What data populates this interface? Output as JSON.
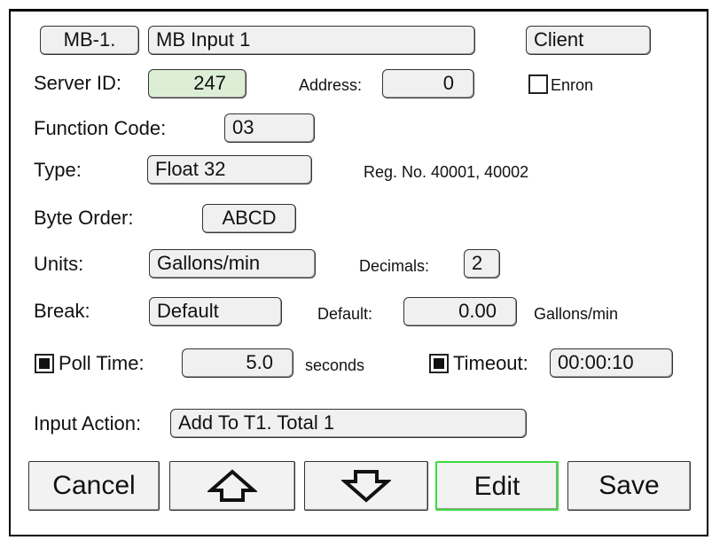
{
  "header": {
    "input_number": "MB-1.",
    "input_name": "MB Input 1",
    "mode": "Client"
  },
  "server_id": {
    "label": "Server ID:",
    "value": "247"
  },
  "address": {
    "label": "Address:",
    "value": "0"
  },
  "enron": {
    "label": "Enron",
    "checked": false
  },
  "function_code": {
    "label": "Function Code:",
    "value": "03"
  },
  "type": {
    "label": "Type:",
    "value": "Float 32",
    "reg_info": "Reg. No. 40001, 40002"
  },
  "byte_order": {
    "label": "Byte Order:",
    "value": "ABCD"
  },
  "units": {
    "label": "Units:",
    "value": "Gallons/min"
  },
  "decimals": {
    "label": "Decimals:",
    "value": "2"
  },
  "break": {
    "label": "Break:",
    "value": "Default"
  },
  "default": {
    "label": "Default:",
    "value": "0.00",
    "units": "Gallons/min"
  },
  "poll_time": {
    "label": "Poll Time:",
    "checked": true,
    "value": "5.0",
    "units": "seconds"
  },
  "timeout": {
    "label": "Timeout:",
    "checked": true,
    "value": "00:00:10"
  },
  "input_action": {
    "label": "Input Action:",
    "value": "Add To T1. Total 1"
  },
  "buttons": {
    "cancel": "Cancel",
    "up": "up-arrow-icon",
    "down": "down-arrow-icon",
    "edit": "Edit",
    "save": "Save"
  },
  "colors": {
    "server_id_bg": "#dcefd6",
    "edit_border": "#3ddc3d"
  }
}
